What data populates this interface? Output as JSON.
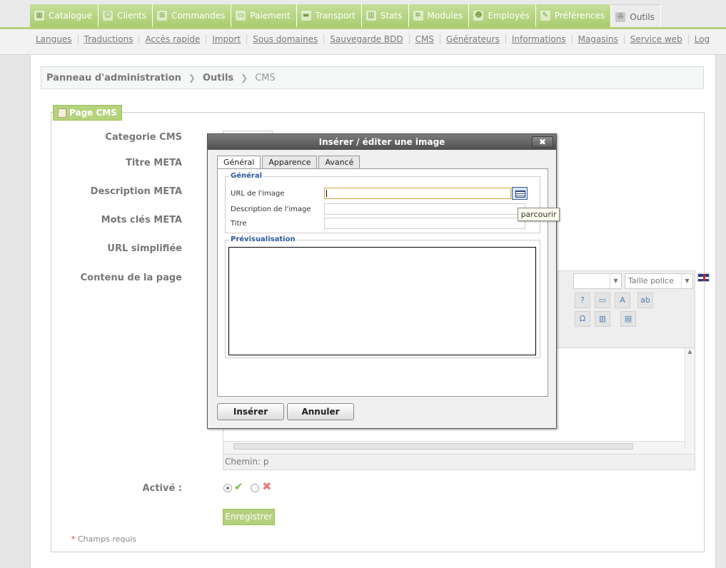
{
  "top_tabs": [
    {
      "label": "Catalogue",
      "icon": "catalog-icon"
    },
    {
      "label": "Clients",
      "icon": "clients-icon"
    },
    {
      "label": "Commandes",
      "icon": "cart-icon"
    },
    {
      "label": "Paiement",
      "icon": "payment-icon"
    },
    {
      "label": "Transport",
      "icon": "truck-icon"
    },
    {
      "label": "Stats",
      "icon": "stats-icon"
    },
    {
      "label": "Modules",
      "icon": "modules-icon"
    },
    {
      "label": "Employés",
      "icon": "employees-icon"
    },
    {
      "label": "Préférences",
      "icon": "preferences-icon"
    },
    {
      "label": "Outils",
      "icon": "wrench-icon",
      "active": true
    }
  ],
  "subnav": [
    "Langues",
    "Traductions",
    "Accès rapide",
    "Import",
    "Sous domaines",
    "Sauvegarde BDD",
    "CMS",
    "Générateurs",
    "Informations",
    "Magasins",
    "Service web",
    "Log"
  ],
  "breadcrumb": {
    "root": "Panneau d'administration",
    "section": "Outils",
    "current": "CMS"
  },
  "form": {
    "legend": "Page CMS",
    "labels": {
      "category": "Categorie CMS",
      "meta_title": "Titre META",
      "meta_description": "Description META",
      "meta_keywords": "Mots clés META",
      "friendly_url": "URL simplifiée",
      "content": "Contenu de la page",
      "active": "Activé :"
    },
    "font_size_select": "Taille police",
    "editor_path": "Chemin: p",
    "save_button": "Enregistrer",
    "required_note": "Champs requis",
    "required_star": "*"
  },
  "modal": {
    "title": "Insérer / éditer une image",
    "close": "✖",
    "tabs": [
      "Général",
      "Apparence",
      "Avancé"
    ],
    "general_group": "Général",
    "fields": {
      "url_label": "URL de l'image",
      "url_value": "",
      "description_label": "Description de l'image",
      "title_label": "Titre"
    },
    "browse_tooltip": "parcourir",
    "preview_group": "Prévisualisation",
    "insert_button": "Insérer",
    "cancel_button": "Annuler"
  },
  "colors": {
    "accent_green": "#b4d07d",
    "modal_title": "#5a5a5a",
    "group_legend": "#2b5a9c"
  }
}
